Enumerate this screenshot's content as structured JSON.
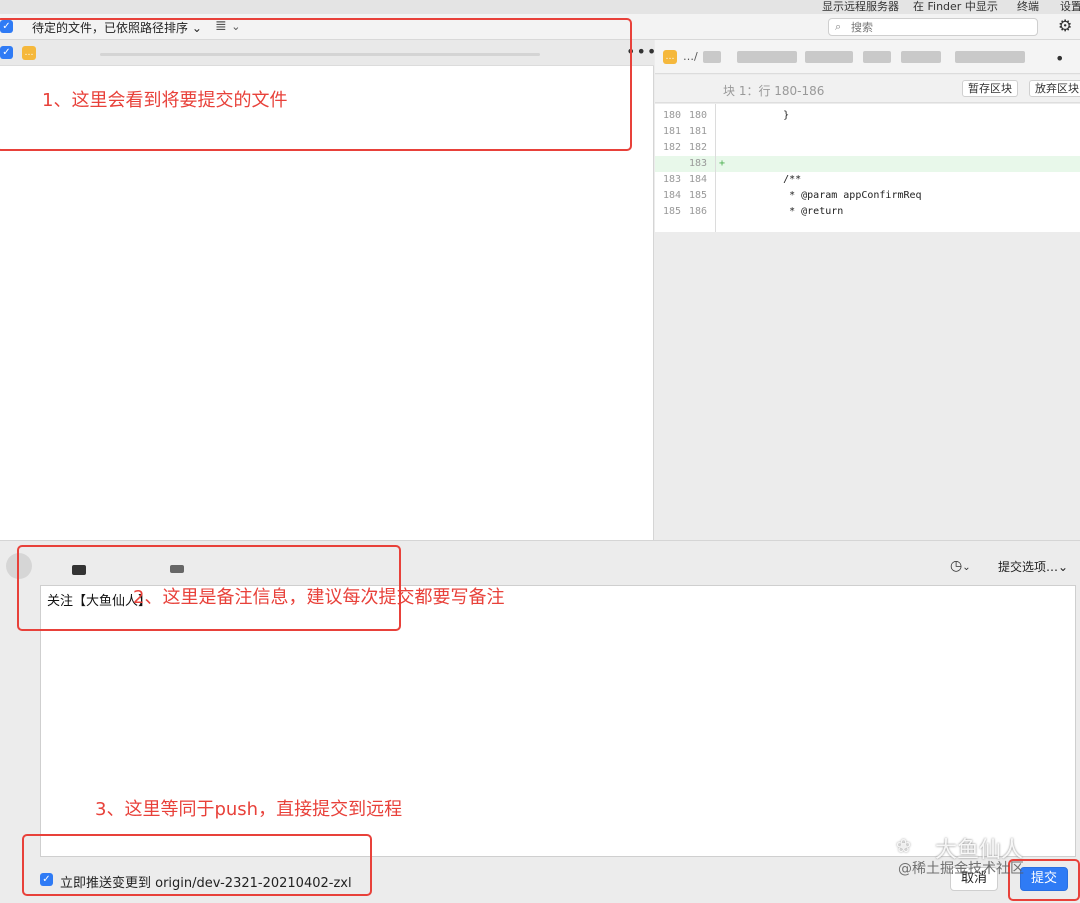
{
  "top_menu": {
    "remote_server": "显示远程服务器",
    "finder": "在 Finder 中显示",
    "terminal": "终端",
    "settings": "设置"
  },
  "toolbar": {
    "sort_label": "待定的文件，已依照路径排序",
    "search_placeholder": "搜索",
    "checkbox_mark": "✓"
  },
  "diff": {
    "path_prefix": "…/",
    "hunk_label": "块 1：行 180-186",
    "stage_hunk": "暂存区块",
    "discard_hunk": "放弃区块",
    "lines": [
      {
        "old": "180",
        "new": "180",
        "mark": "",
        "text": "    }",
        "added": false
      },
      {
        "old": "181",
        "new": "181",
        "mark": "",
        "text": "",
        "added": false
      },
      {
        "old": "182",
        "new": "182",
        "mark": "",
        "text": "",
        "added": false
      },
      {
        "old": "",
        "new": "183",
        "mark": "+",
        "text": "",
        "added": true
      },
      {
        "old": "183",
        "new": "184",
        "mark": "",
        "text": "    /**",
        "added": false
      },
      {
        "old": "184",
        "new": "185",
        "mark": "",
        "text": "     * @param appConfirmReq",
        "added": false
      },
      {
        "old": "185",
        "new": "186",
        "mark": "",
        "text": "     * @return",
        "added": false
      }
    ]
  },
  "commit": {
    "options_label": "提交选项…",
    "message": "关注【大鱼仙人】",
    "push_label": "立即推送变更到 origin/dev-2321-20210402-zxl",
    "cancel_label": "取消",
    "commit_label": "提交"
  },
  "annotations": {
    "note1": "1、这里会看到将要提交的文件",
    "note2": "2、这里是备注信息，建议每次提交都要写备注",
    "note3": "3、这里等同于push，直接提交到远程"
  },
  "watermark": {
    "name": "大鱼仙人",
    "site": "@稀土掘金技术社区"
  },
  "colors": {
    "accent": "#2f7bf5",
    "annotation": "#e8413a",
    "file_status": "#f5b83c",
    "added_line": "#e8f8ea"
  }
}
